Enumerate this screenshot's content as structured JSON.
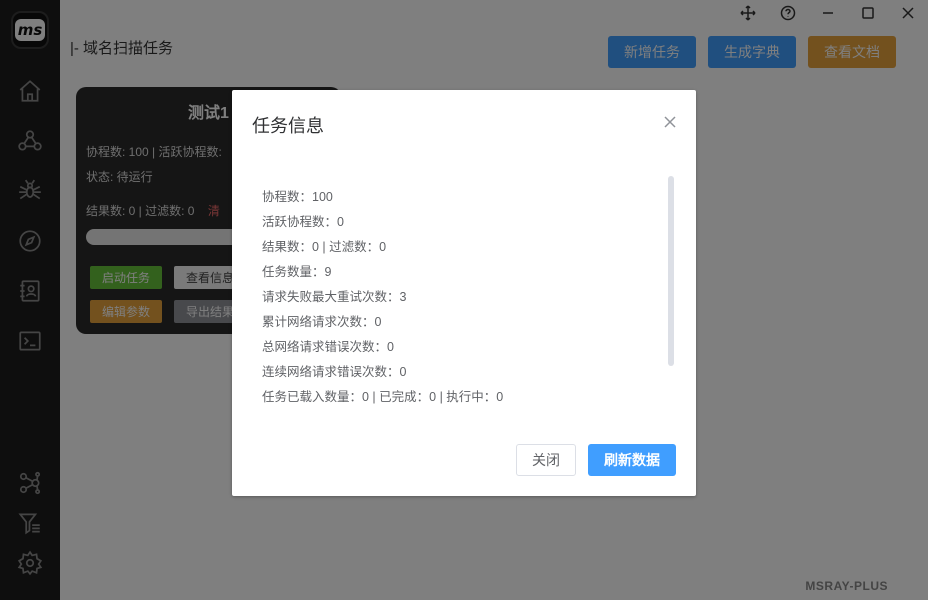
{
  "app": {
    "logo_text": "ms",
    "watermark": "MSRAY-PLUS"
  },
  "sidebar": {
    "items": [
      {
        "icon": "home-icon"
      },
      {
        "icon": "share-nodes-icon"
      },
      {
        "icon": "spider-icon"
      },
      {
        "icon": "compass-icon"
      },
      {
        "icon": "contact-book-icon"
      },
      {
        "icon": "terminal-icon"
      },
      {
        "icon": "graph-icon"
      },
      {
        "icon": "filter-list-icon"
      },
      {
        "icon": "gear-icon"
      }
    ]
  },
  "window": {
    "icons": [
      "move-icon",
      "help-icon",
      "minimize-icon",
      "maximize-icon",
      "close-icon"
    ]
  },
  "header": {
    "title": "|- 域名扫描任务",
    "add_task": "新增任务",
    "gen_dict": "生成字典",
    "view_docs": "查看文档"
  },
  "task_card": {
    "name": "测试1",
    "coroutines": "协程数: 100 | 活跃协程数:",
    "status": "状态: 待运行",
    "results": "结果数: 0 | 过滤数: 0",
    "clear": "清",
    "start": "启动任务",
    "view_info": "查看信息",
    "edit_params": "编辑参数",
    "export": "导出结果"
  },
  "dialog": {
    "title": "任务信息",
    "rows": [
      "协程数：100",
      "活跃协程数：0",
      "结果数：0 | 过滤数：0",
      "任务数量：9",
      "请求失败最大重试次数：3",
      "累计网络请求次数：0",
      "总网络请求错误次数：0",
      "连续网络请求错误次数：0",
      "任务已载入数量：0 | 已完成：0 | 执行中：0"
    ],
    "close_btn": "关闭",
    "refresh_btn": "刷新数据"
  },
  "colors": {
    "primary": "#409eff",
    "warning": "#e6a23c",
    "success": "#67c23a",
    "sidebar_bg": "#1c1c1c"
  }
}
